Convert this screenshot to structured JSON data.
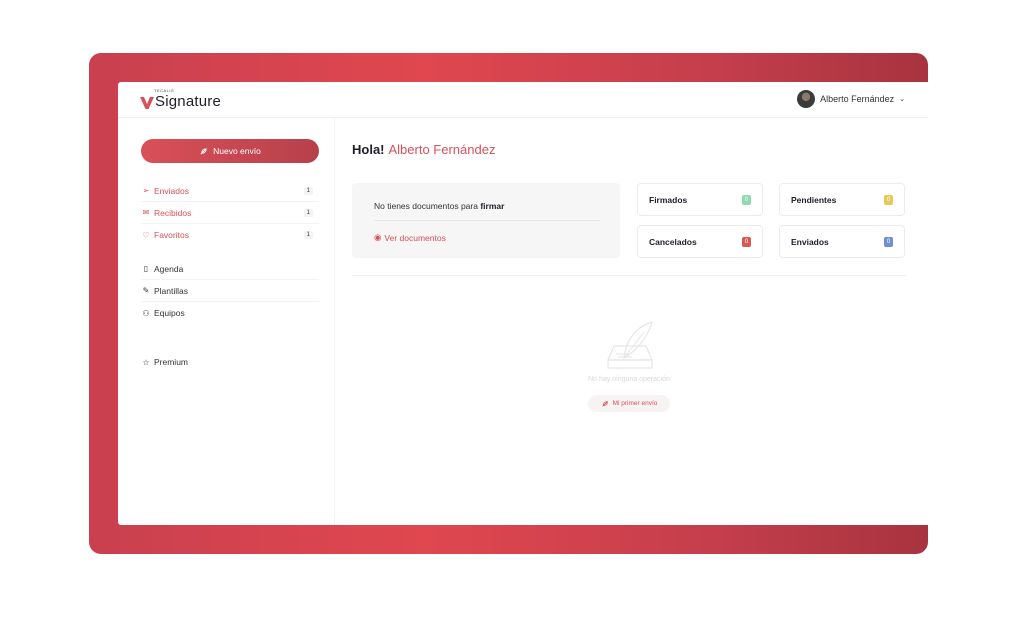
{
  "brand": {
    "small_text": "TECALIS",
    "name": "Signature",
    "accent": "#d9505a"
  },
  "user": {
    "name": "Alberto Fernández"
  },
  "sidebar": {
    "new_button": "Nuevo envío",
    "primary": [
      {
        "label": "Enviados",
        "count": "1",
        "icon": "send-icon"
      },
      {
        "label": "Recibidos",
        "count": "1",
        "icon": "inbox-icon"
      },
      {
        "label": "Favoritos",
        "count": "1",
        "icon": "heart-icon"
      }
    ],
    "secondary": [
      {
        "label": "Agenda",
        "icon": "book-icon"
      },
      {
        "label": "Plantillas",
        "icon": "edit-icon"
      },
      {
        "label": "Equipos",
        "icon": "users-icon"
      }
    ],
    "premium": {
      "label": "Premium",
      "icon": "star-icon"
    }
  },
  "main": {
    "greeting": "Hola!",
    "greeting_name": "Alberto Fernández",
    "docs": {
      "text": "No tienes documentos para",
      "text_bold": "firmar",
      "link": "Ver documentos"
    },
    "stats": [
      {
        "label": "Firmados",
        "count": "0",
        "color": "#8fd9b0"
      },
      {
        "label": "Pendientes",
        "count": "0",
        "color": "#e9c85a"
      },
      {
        "label": "Cancelados",
        "count": "0",
        "color": "#d45a52"
      },
      {
        "label": "Enviados",
        "count": "0",
        "color": "#6f8fd0"
      }
    ],
    "empty": {
      "text": "No hay ninguna operación",
      "button": "Mi primer envío"
    }
  }
}
